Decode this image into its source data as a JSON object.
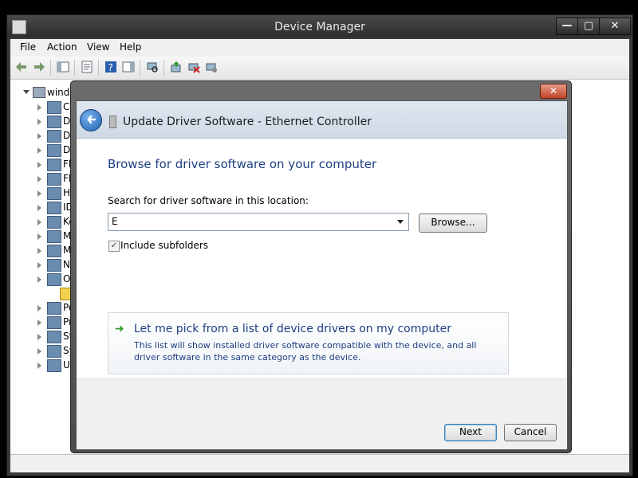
{
  "window": {
    "title": "Device Manager"
  },
  "caption_buttons": {
    "minimize": "—",
    "maximize": "▢",
    "close": "✕"
  },
  "menu": [
    "File",
    "Action",
    "View",
    "Help"
  ],
  "tree": {
    "root": "windo",
    "items": [
      "Co",
      "Di",
      "Di",
      "DV",
      "Fl",
      "Fl",
      "Hu",
      "ID",
      "Ke",
      "Mi",
      "Mi",
      "Ne",
      "Ot",
      "",
      "Po",
      "Pr",
      "St",
      "Sy",
      "Ur"
    ]
  },
  "dialog": {
    "close_glyph": "✕",
    "title": "Update Driver Software - Ethernet Controller",
    "heading": "Browse for driver software on your computer",
    "search_label": "Search for driver software in this location:",
    "path_value": "E",
    "browse_label": "Browse...",
    "subfolders_label": "Include subfolders",
    "subfolders_checked": true,
    "pick_option": {
      "title": "Let me pick from a list of device drivers on my computer",
      "description": "This list will show installed driver software compatible with the device, and all driver software in the same category as the device."
    },
    "next_label": "Next",
    "cancel_label": "Cancel"
  },
  "colors": {
    "link_blue": "#1e3f83",
    "green_arrow": "#2f9a2f",
    "close_red": "#c0442a"
  }
}
